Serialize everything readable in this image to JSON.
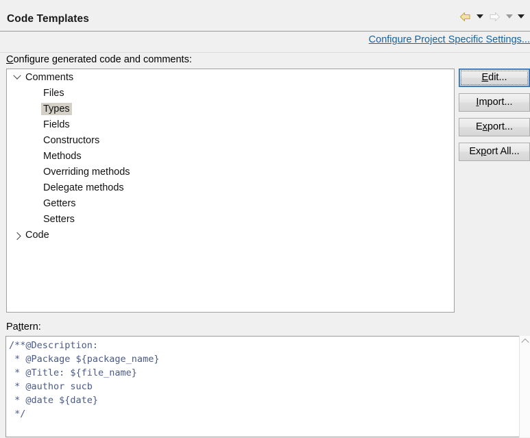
{
  "header": {
    "title": "Code Templates",
    "nav": {
      "back_icon": "back-arrow-icon",
      "back_menu_icon": "chevron-down-icon",
      "forward_icon": "forward-arrow-icon",
      "forward_menu_icon": "chevron-down-icon",
      "more_menu_icon": "chevron-down-icon"
    }
  },
  "link_bar": {
    "project_settings_link": "Configure Project Specific Settings..."
  },
  "main": {
    "tree_label_pre": "C",
    "tree_label_post": "onfigure generated code and comments:",
    "tree": [
      {
        "label": "Comments",
        "level": 0,
        "expanded": true,
        "twisty": "chevron-down-icon",
        "selected": false
      },
      {
        "label": "Files",
        "level": 1,
        "expanded": false,
        "twisty": "",
        "selected": false
      },
      {
        "label": "Types",
        "level": 1,
        "expanded": false,
        "twisty": "",
        "selected": true
      },
      {
        "label": "Fields",
        "level": 1,
        "expanded": false,
        "twisty": "",
        "selected": false
      },
      {
        "label": "Constructors",
        "level": 1,
        "expanded": false,
        "twisty": "",
        "selected": false
      },
      {
        "label": "Methods",
        "level": 1,
        "expanded": false,
        "twisty": "",
        "selected": false
      },
      {
        "label": "Overriding methods",
        "level": 1,
        "expanded": false,
        "twisty": "",
        "selected": false
      },
      {
        "label": "Delegate methods",
        "level": 1,
        "expanded": false,
        "twisty": "",
        "selected": false
      },
      {
        "label": "Getters",
        "level": 1,
        "expanded": false,
        "twisty": "",
        "selected": false
      },
      {
        "label": "Setters",
        "level": 1,
        "expanded": false,
        "twisty": "",
        "selected": false
      },
      {
        "label": "Code",
        "level": 0,
        "expanded": false,
        "twisty": "chevron-right-icon",
        "selected": false
      }
    ],
    "buttons": [
      {
        "name": "edit",
        "mnemonic": "E",
        "before": "",
        "after": "dit...",
        "focused": true
      },
      {
        "name": "import",
        "mnemonic": "I",
        "before": "",
        "after": "mport...",
        "focused": false
      },
      {
        "name": "export",
        "mnemonic": "x",
        "before": "E",
        "after": "port...",
        "focused": false
      },
      {
        "name": "export-all",
        "mnemonic": "p",
        "before": "Ex",
        "after": "ort All...",
        "focused": false
      }
    ]
  },
  "pattern": {
    "label_pre": "Pa",
    "label_mn": "t",
    "label_post": "tern:",
    "code": "/**@Description:\n * @Package ${package_name}\n * @Title: ${file_name}\n * @author sucb\n * @date ${date}\n */",
    "scroll_up_icon": "chevron-up-icon"
  },
  "colors": {
    "background": "#f0f0f0",
    "link": "#1464a0",
    "selection": "#d4d0c8",
    "code_text": "#4a5a8a",
    "focus_border": "#2f6fab",
    "back_arrow": "#e8cf7a"
  }
}
